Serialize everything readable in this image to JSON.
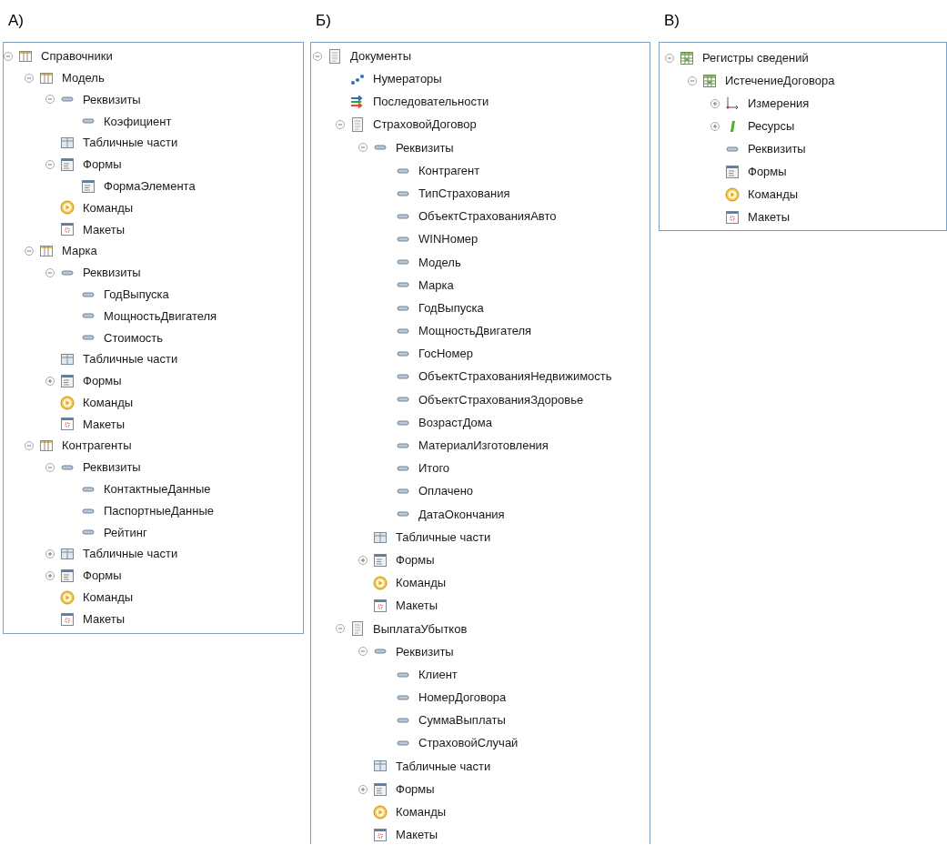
{
  "panels": [
    {
      "heading": "А)",
      "tree": [
        {
          "label": "Справочники",
          "kind": "catalog",
          "expanded": true,
          "children": [
            {
              "label": "Модель",
              "kind": "catalog",
              "expanded": true,
              "children": [
                {
                  "label": "Реквизиты",
                  "kind": "attribute",
                  "expanded": true,
                  "children": [
                    {
                      "label": "Коэфициент",
                      "kind": "attribute"
                    }
                  ]
                },
                {
                  "label": "Табличные части",
                  "kind": "tabular"
                },
                {
                  "label": "Формы",
                  "kind": "forms",
                  "expanded": true,
                  "children": [
                    {
                      "label": "ФормаЭлемента",
                      "kind": "forms"
                    }
                  ]
                },
                {
                  "label": "Команды",
                  "kind": "commands"
                },
                {
                  "label": "Макеты",
                  "kind": "templates"
                }
              ]
            },
            {
              "label": "Марка",
              "kind": "catalog",
              "expanded": true,
              "children": [
                {
                  "label": "Реквизиты",
                  "kind": "attribute",
                  "expanded": true,
                  "children": [
                    {
                      "label": "ГодВыпуска",
                      "kind": "attribute"
                    },
                    {
                      "label": "МощностьДвигателя",
                      "kind": "attribute"
                    },
                    {
                      "label": "Стоимость",
                      "kind": "attribute"
                    }
                  ]
                },
                {
                  "label": "Табличные части",
                  "kind": "tabular"
                },
                {
                  "label": "Формы",
                  "kind": "forms",
                  "expanded": false
                },
                {
                  "label": "Команды",
                  "kind": "commands"
                },
                {
                  "label": "Макеты",
                  "kind": "templates"
                }
              ]
            },
            {
              "label": "Контрагенты",
              "kind": "catalog",
              "expanded": true,
              "children": [
                {
                  "label": "Реквизиты",
                  "kind": "attribute",
                  "expanded": true,
                  "children": [
                    {
                      "label": "КонтактныеДанные",
                      "kind": "attribute"
                    },
                    {
                      "label": "ПаспортныеДанные",
                      "kind": "attribute"
                    },
                    {
                      "label": "Рейтинг",
                      "kind": "attribute"
                    }
                  ]
                },
                {
                  "label": "Табличные части",
                  "kind": "tabular",
                  "expanded": false
                },
                {
                  "label": "Формы",
                  "kind": "forms",
                  "expanded": false
                },
                {
                  "label": "Команды",
                  "kind": "commands"
                },
                {
                  "label": "Макеты",
                  "kind": "templates"
                }
              ]
            }
          ]
        }
      ]
    },
    {
      "heading": "Б)",
      "tree": [
        {
          "label": "Документы",
          "kind": "document",
          "expanded": true,
          "children": [
            {
              "label": "Нумераторы",
              "kind": "numerators"
            },
            {
              "label": "Последовательности",
              "kind": "sequences"
            },
            {
              "label": "СтраховойДоговор",
              "kind": "document",
              "expanded": true,
              "children": [
                {
                  "label": "Реквизиты",
                  "kind": "attribute",
                  "expanded": true,
                  "children": [
                    {
                      "label": "Контрагент",
                      "kind": "attribute"
                    },
                    {
                      "label": "ТипСтрахования",
                      "kind": "attribute"
                    },
                    {
                      "label": "ОбъектСтрахованияАвто",
                      "kind": "attribute"
                    },
                    {
                      "label": "WINНомер",
                      "kind": "attribute"
                    },
                    {
                      "label": "Модель",
                      "kind": "attribute"
                    },
                    {
                      "label": "Марка",
                      "kind": "attribute"
                    },
                    {
                      "label": "ГодВыпуска",
                      "kind": "attribute"
                    },
                    {
                      "label": "МощностьДвигателя",
                      "kind": "attribute"
                    },
                    {
                      "label": "ГосНомер",
                      "kind": "attribute"
                    },
                    {
                      "label": "ОбъектСтрахованияНедвижимость",
                      "kind": "attribute"
                    },
                    {
                      "label": "ОбъектСтрахованияЗдоровье",
                      "kind": "attribute"
                    },
                    {
                      "label": "ВозрастДома",
                      "kind": "attribute"
                    },
                    {
                      "label": "МатериалИзготовления",
                      "kind": "attribute"
                    },
                    {
                      "label": "Итого",
                      "kind": "attribute"
                    },
                    {
                      "label": "Оплачено",
                      "kind": "attribute"
                    },
                    {
                      "label": "ДатаОкончания",
                      "kind": "attribute"
                    }
                  ]
                },
                {
                  "label": "Табличные части",
                  "kind": "tabular"
                },
                {
                  "label": "Формы",
                  "kind": "forms",
                  "expanded": false
                },
                {
                  "label": "Команды",
                  "kind": "commands"
                },
                {
                  "label": "Макеты",
                  "kind": "templates"
                }
              ]
            },
            {
              "label": "ВыплатаУбытков",
              "kind": "document",
              "expanded": true,
              "children": [
                {
                  "label": "Реквизиты",
                  "kind": "attribute",
                  "expanded": true,
                  "children": [
                    {
                      "label": "Клиент",
                      "kind": "attribute"
                    },
                    {
                      "label": "НомерДоговора",
                      "kind": "attribute"
                    },
                    {
                      "label": "СуммаВыплаты",
                      "kind": "attribute"
                    },
                    {
                      "label": "СтраховойСлучай",
                      "kind": "attribute"
                    }
                  ]
                },
                {
                  "label": "Табличные части",
                  "kind": "tabular"
                },
                {
                  "label": "Формы",
                  "kind": "forms",
                  "expanded": false
                },
                {
                  "label": "Команды",
                  "kind": "commands"
                },
                {
                  "label": "Макеты",
                  "kind": "templates"
                }
              ]
            }
          ]
        }
      ]
    },
    {
      "heading": "В)",
      "tree": [
        {
          "label": "Регистры сведений",
          "kind": "register",
          "expanded": true,
          "children": [
            {
              "label": "ИстечениеДоговора",
              "kind": "register",
              "expanded": true,
              "children": [
                {
                  "label": "Измерения",
                  "kind": "dimensions",
                  "expanded": false
                },
                {
                  "label": "Ресурсы",
                  "kind": "resources",
                  "expanded": false
                },
                {
                  "label": "Реквизиты",
                  "kind": "attribute"
                },
                {
                  "label": "Формы",
                  "kind": "forms"
                },
                {
                  "label": "Команды",
                  "kind": "commands"
                },
                {
                  "label": "Макеты",
                  "kind": "templates"
                }
              ]
            }
          ]
        }
      ]
    }
  ]
}
